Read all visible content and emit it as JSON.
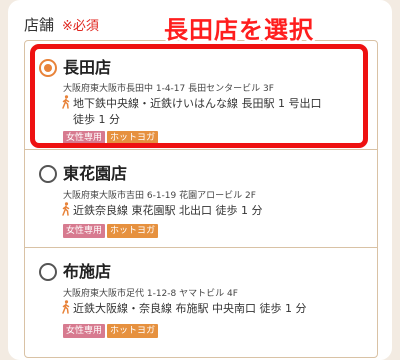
{
  "form": {
    "field_label": "店舗",
    "required_mark": "※必須"
  },
  "annotation": "長田店を選択",
  "stores": [
    {
      "name": "長田店",
      "address": "大阪府東大阪市長田中 1-4-17 長田センタービル 3F",
      "access_line1": "地下鉄中央線・近鉄けいはんな線 長田駅 1 号出口",
      "access_line2": "徒歩 1 分",
      "tags": [
        "女性専用",
        "ホットヨガ"
      ],
      "selected": true
    },
    {
      "name": "東花園店",
      "address": "大阪府東大阪市吉田 6-1-19 花園アロービル 2F",
      "access_line1": "近鉄奈良線 東花園駅 北出口 徒歩 1 分",
      "tags": [
        "女性専用",
        "ホットヨガ"
      ],
      "selected": false
    },
    {
      "name": "布施店",
      "address": "大阪府東大阪市足代 1-12-8 ヤマトビル 4F",
      "access_line1": "近鉄大阪線・奈良線 布施駅 中央南口 徒歩 1 分",
      "tags": [
        "女性専用",
        "ホットヨガ"
      ],
      "selected": false
    }
  ],
  "colors": {
    "accent_orange": "#e8833a",
    "tag_pink": "#d77a8f",
    "tag_orange": "#e6913f",
    "highlight_red": "#ee1111",
    "required_red": "#e0261f"
  },
  "icons": {
    "walk": "walking-person-icon"
  }
}
